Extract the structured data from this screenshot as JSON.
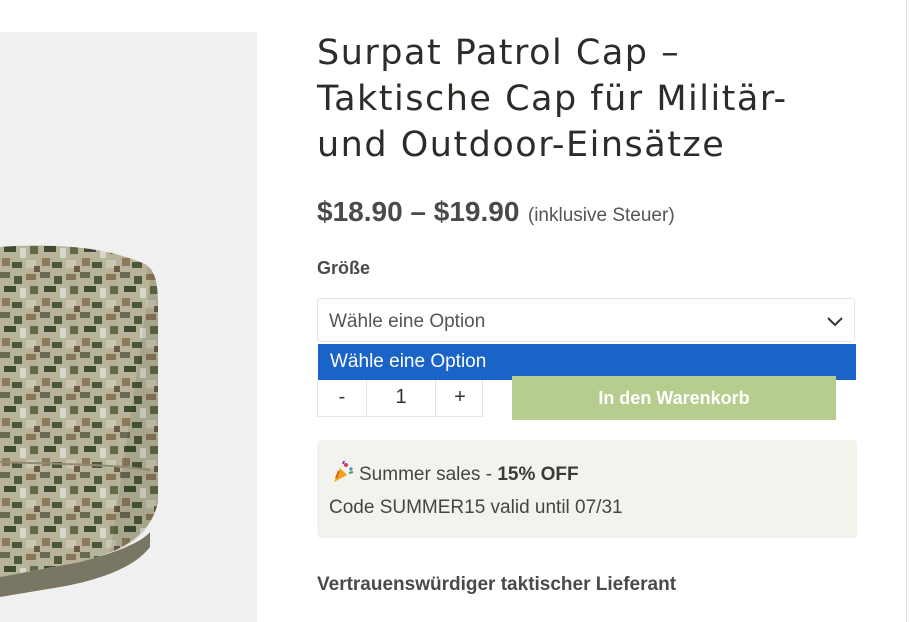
{
  "product": {
    "title_line1": "Surpat Patrol Cap –",
    "title_line2": "Taktische Cap für Militär-",
    "title_line3": "und Outdoor-Einsätze",
    "price_range": "$18.90 – $19.90",
    "price_note": "(inklusive Steuer)"
  },
  "size": {
    "label": "Größe",
    "selected": "Wähle eine Option",
    "dropdown_options": [
      "Wähle eine Option"
    ]
  },
  "quantity": {
    "minus": "-",
    "value": "1",
    "plus": "+"
  },
  "cart": {
    "button_label": "In den Warenkorb"
  },
  "promo": {
    "icon": "party-popper-icon",
    "prefix": "Summer sales - ",
    "discount": "15% OFF",
    "code_line": "Code SUMMER15 valid until 07/31"
  },
  "trust": {
    "heading": "Vertrauenswürdiger taktischer Lieferant"
  },
  "colors": {
    "dropdown_highlight": "#1a63c9",
    "cart_button": "#b7cd8e",
    "promo_background": "#f3f3ee"
  }
}
